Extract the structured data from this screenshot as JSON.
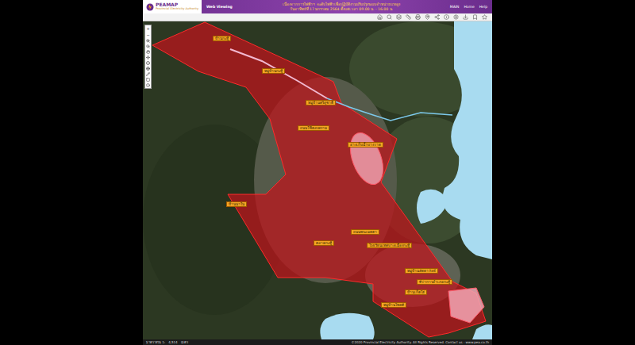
{
  "header": {
    "logo": "PEAMAP",
    "org": "Provincial Electricity Authority",
    "app": "Web Viewing",
    "notice": [
      "เนื่องจากการไฟฟ้าฯ จะดับไฟฟ้าเพื่อปฏิบัติงานปรับปรุงระบบจำหน่ายแรงสูง",
      "วันอาทิตย์ที่ 17 มกราคม 2564 ตั้งแต่เวลา 09.00 น. - 16.00 น."
    ],
    "nav": [
      "MAIN",
      "Home",
      "Help"
    ]
  },
  "zoom": [
    "+",
    "−"
  ],
  "map_labels": [
    {
      "text": "บ้านกะทู้"
    },
    {
      "text": "หมู่บ้านกะทู้"
    },
    {
      "text": "หมู่บ้านศรีสุชาติ"
    },
    {
      "text": "ถนนวิชิตสงคราม"
    },
    {
      "text": "อ่างเก็บน้ำบางวาด"
    },
    {
      "text": "บ้านนาใน"
    },
    {
      "text": "ตลาดกะทู้"
    },
    {
      "text": "ถนนพระเมตตา"
    },
    {
      "text": "โรงเรียนเทศบาลเมืองกะทู้"
    },
    {
      "text": "หมู่บ้านลัดดาวัลย์"
    },
    {
      "text": "ที่ว่าการอำเภอกะทู้"
    },
    {
      "text": "บ้านเก็ตโฮ่"
    },
    {
      "text": "หมู่บ้านโชคดี"
    }
  ],
  "status_bar": {
    "scale_label": "มาตราส่วน 1:",
    "scale": "4,514",
    "unit": "เมตร",
    "copyright": "©2020 Provincial Electricity Authority. All Rights Reserved. Contact us : www.pea.co.th"
  }
}
